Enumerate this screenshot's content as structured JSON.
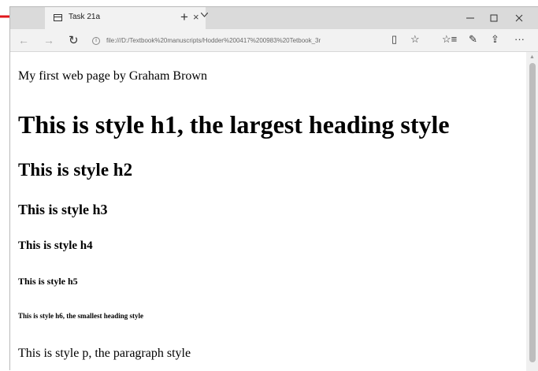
{
  "tab": {
    "title": "Task 21a",
    "close": "×"
  },
  "toolbar": {
    "new_tab": "+",
    "back": "←",
    "forward": "→",
    "refresh": "↻",
    "url": "file:///D:/Textbook%20manuscripts/Hodder%200417%200983%20Tetbook_3r",
    "reading_view": "▯",
    "favorite": "☆",
    "favorites_hub": "☆≡",
    "notes": "✎",
    "share": "⇪",
    "more": "···"
  },
  "page": {
    "p1": "My first web page by Graham Brown",
    "h1": "This is style h1, the largest heading style",
    "h2": "This is style h2",
    "h3": "This is style h3",
    "h4": "This is style h4",
    "h5": "This is style h5",
    "h6": "This is style h6, the smallest heading style",
    "p2": "This is style p, the paragraph style"
  },
  "colors": {
    "annotation_arrow": "#e0161b",
    "tabbar": "#dadada",
    "toolbar": "#f2f2f2"
  }
}
